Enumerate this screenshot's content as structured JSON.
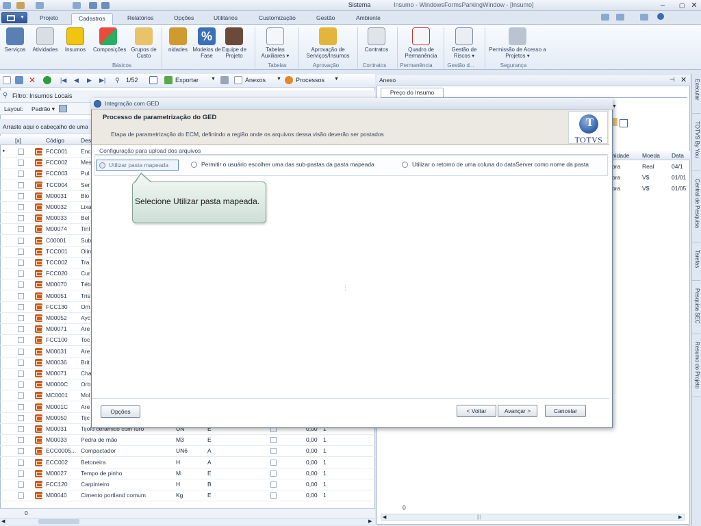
{
  "app": {
    "title": "Sistema",
    "window_title": "Insumo - WindowsFormsParkingWindow - [Insumo]"
  },
  "ribbon_tabs": [
    "Projeto",
    "Cadastros",
    "Relatórios",
    "Opções",
    "Utilitários",
    "Customização",
    "Gestão",
    "Ambiente"
  ],
  "ribbon": {
    "buttons": [
      {
        "label": "Serviços"
      },
      {
        "label": "Atividades"
      },
      {
        "label": "Insumos"
      },
      {
        "label": "Composições"
      },
      {
        "label": "Grupos de Custo"
      },
      {
        "label": "nidades"
      },
      {
        "label": "Modelos de Fase"
      },
      {
        "label": "Equipe de Projeto"
      },
      {
        "label": "Tabelas Auxiliares ▾"
      },
      {
        "label": "Aprovação de Serviços/Insumos"
      },
      {
        "label": "Contratos"
      },
      {
        "label": "Quadro de Permanência"
      },
      {
        "label": "Gestão de Riscos ▾"
      },
      {
        "label": "Permissão de Acesso a Projetos ▾"
      }
    ],
    "groups": [
      "Básicos",
      "Tabelas",
      "Aprovação",
      "Contratos",
      "Permanência",
      "Gestão d...",
      "Segurança"
    ]
  },
  "left_toolbar": {
    "page": "1/52",
    "export_label": "Exportar",
    "attachments_label": "Anexos",
    "processes_label": "Processos"
  },
  "filter": {
    "label": "Filtro: Insumos Locais"
  },
  "layout": {
    "label": "Layout:",
    "value": "Padrão ▾"
  },
  "group_prompt": "Arraste aqui o cabeçalho de uma coluna para agrupar",
  "grid": {
    "headers": [
      "[x]",
      "Código",
      "Des"
    ],
    "rows": [
      {
        "code": "FCC001",
        "desc": "Enc"
      },
      {
        "code": "FCC002",
        "desc": "Mes"
      },
      {
        "code": "FCC003",
        "desc": "Pul"
      },
      {
        "code": "TCC004",
        "desc": "Ser"
      },
      {
        "code": "M00031",
        "desc": "Blo"
      },
      {
        "code": "M00032",
        "desc": "Lixa"
      },
      {
        "code": "M00033",
        "desc": "Bel"
      },
      {
        "code": "M00074",
        "desc": "Tinl"
      },
      {
        "code": "C00001",
        "desc": "Sub"
      },
      {
        "code": "TCC001",
        "desc": "Olin"
      },
      {
        "code": "TCC002",
        "desc": "Tra"
      },
      {
        "code": "FCC020",
        "desc": "Cur"
      },
      {
        "code": "M00070",
        "desc": "Téb"
      },
      {
        "code": "M00051",
        "desc": "Tris"
      },
      {
        "code": "FCC130",
        "desc": "Om"
      },
      {
        "code": "M00052",
        "desc": "Ayc"
      },
      {
        "code": "M00071",
        "desc": "Are"
      },
      {
        "code": "FCC100",
        "desc": "Toc"
      },
      {
        "code": "M00031",
        "desc": "Are"
      },
      {
        "code": "M00036",
        "desc": "Brit"
      },
      {
        "code": "M00071",
        "desc": "Cha"
      },
      {
        "code": "M0000C",
        "desc": "Orb"
      },
      {
        "code": "MC0001",
        "desc": "Mol"
      },
      {
        "code": "M0001C",
        "desc": "Are"
      },
      {
        "code": "M00050",
        "desc": "Tijc"
      },
      {
        "code": "M00031",
        "desc": "Tijolo cerâmico com furo",
        "un": "UN",
        "cl": "E",
        "val": "0,00",
        "q": "1"
      },
      {
        "code": "M00033",
        "desc": "Pedra de mão",
        "un": "M3",
        "cl": "E",
        "val": "0,00",
        "q": "1"
      },
      {
        "code": "ECC0005...",
        "desc": "Compactador",
        "un": "UN6",
        "cl": "A",
        "val": "0,00",
        "q": "1"
      },
      {
        "code": "ECC002",
        "desc": "Betoneira",
        "un": "H",
        "cl": "A",
        "val": "0,00",
        "q": "1"
      },
      {
        "code": "M00027",
        "desc": "Tempo de pinho",
        "un": "M",
        "cl": "E",
        "val": "0,00",
        "q": "1"
      },
      {
        "code": "FCC120",
        "desc": "Carpinteiro",
        "un": "H",
        "cl": "B",
        "val": "0,00",
        "q": "1"
      },
      {
        "code": "M00040",
        "desc": "Cimento portland comum",
        "un": "Kg",
        "cl": "E",
        "val": "0,00",
        "q": "1"
      }
    ],
    "status_count": "0"
  },
  "right_panel": {
    "title": "Anexo",
    "tab": "Preço do Insumo",
    "columns": [
      "nidade",
      "Moeda",
      "Data"
    ],
    "rows": [
      {
        "a": "ora",
        "b": "Real",
        "c": "04/1"
      },
      {
        "a": "ora",
        "b": "V$",
        "c": "01/01"
      },
      {
        "a": "ora",
        "b": "V$",
        "c": "01/05"
      }
    ],
    "status_count": "0"
  },
  "side_tabs": [
    "Executar",
    "TOTVS By You",
    "Central de Pesquisa",
    "Tarefas",
    "Pesquisa SEC",
    "Resumo do Projeto"
  ],
  "dialog": {
    "title": "Integração com GED",
    "banner_title": "Processo de parametrização do GED",
    "banner_subtitle": "Etapa de parametrização do ECM, definindo a região onde os arquivos dessa visão deverão ser postados",
    "logo_text": "TOTVS",
    "section_label": "Configuração para upload dos arquivos",
    "options": [
      {
        "label": "Utilizar pasta mapeada"
      },
      {
        "label": "Permitir o usuário escolher uma das sub-pastas da pasta mapeada"
      },
      {
        "label": "Utilizar o retorno de uma coluna do dataServer como nome da pasta"
      }
    ],
    "callout_text": "Selecione Utilizar pasta mapeada.",
    "buttons": {
      "options": "Opções",
      "back": "< Voltar",
      "next": "Avançar >",
      "cancel": "Cancelar"
    }
  },
  "colors": {
    "accent": "#2e5596",
    "dialog_banner": "#ece9e2",
    "callout_bg": "#dbe9e1"
  }
}
